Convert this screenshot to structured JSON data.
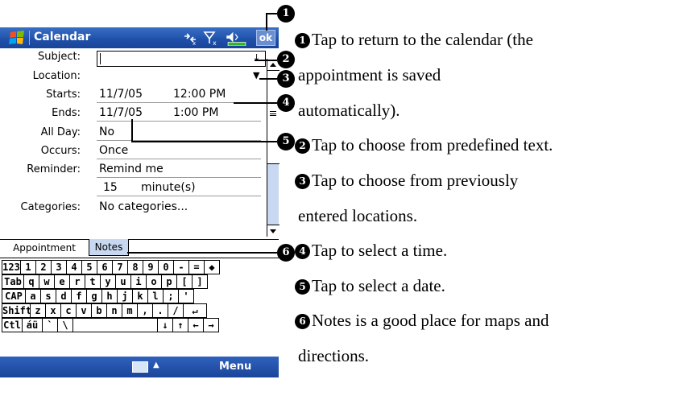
{
  "titlebar": {
    "app_title": "Calendar",
    "ok_label": "ok"
  },
  "form": {
    "subject_label": "Subject:",
    "subject_value": "",
    "location_label": "Location:",
    "location_value": "",
    "starts_label": "Starts:",
    "starts_date": "11/7/05",
    "starts_time": "12:00 PM",
    "ends_label": "Ends:",
    "ends_date": "11/7/05",
    "ends_time": "1:00 PM",
    "allday_label": "All Day:",
    "allday_value": "No",
    "occurs_label": "Occurs:",
    "occurs_value": "Once",
    "reminder_label": "Reminder:",
    "reminder_value": "Remind me",
    "reminder_amount": "15",
    "reminder_unit": "minute(s)",
    "categories_label": "Categories:",
    "categories_value": "No categories..."
  },
  "tabs": [
    {
      "label": "Appointment"
    },
    {
      "label": "Notes"
    }
  ],
  "keyboard": {
    "rows": [
      [
        "123",
        "1",
        "2",
        "3",
        "4",
        "5",
        "6",
        "7",
        "8",
        "9",
        "0",
        "-",
        "=",
        "◆"
      ],
      [
        "Tab",
        "q",
        "w",
        "e",
        "r",
        "t",
        "y",
        "u",
        "i",
        "o",
        "p",
        "[",
        "]"
      ],
      [
        "CAP",
        "a",
        "s",
        "d",
        "f",
        "g",
        "h",
        "j",
        "k",
        "l",
        ";",
        "'"
      ],
      [
        "Shift",
        "z",
        "x",
        "c",
        "v",
        "b",
        "n",
        "m",
        ",",
        ".",
        "/",
        "↵"
      ],
      [
        "Ctl",
        "áü",
        "`",
        "\\",
        "",
        "↓",
        "↑",
        "←",
        "→"
      ]
    ]
  },
  "menubar": {
    "menu_label": "Menu"
  },
  "markers": [
    "1",
    "2",
    "3",
    "4",
    "5",
    "6"
  ],
  "descriptions": [
    {
      "num": "1",
      "lines": [
        "Tap to return to the calendar (the",
        "appointment is saved",
        "automatically)."
      ]
    },
    {
      "num": "2",
      "lines": [
        "Tap to choose from predefined text."
      ]
    },
    {
      "num": "3",
      "lines": [
        "Tap to choose from previously",
        "entered locations."
      ]
    },
    {
      "num": "4",
      "lines": [
        "Tap to select a time."
      ]
    },
    {
      "num": "5",
      "lines": [
        "Tap to select a date."
      ]
    },
    {
      "num": "6",
      "lines": [
        "Notes is a good place for maps and",
        "directions."
      ]
    }
  ],
  "colors": {
    "titlebar": "#1e4fa8",
    "scrollbar": "#c8d8f0",
    "battery": "#2fb52f"
  },
  "icons": [
    "windows-logo-icon",
    "connectivity-icon",
    "signal-icon",
    "volume-icon",
    "battery-icon",
    "keyboard-icon"
  ]
}
